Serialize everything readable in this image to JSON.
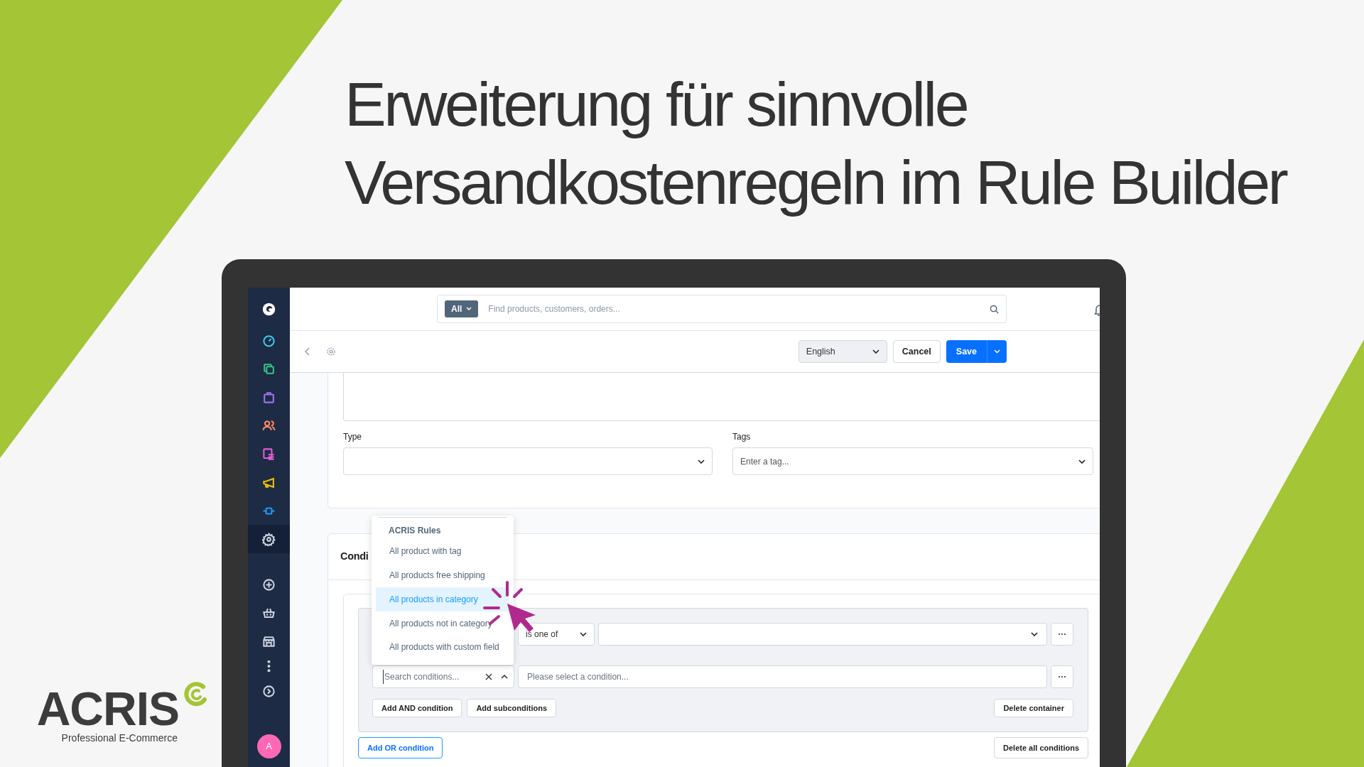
{
  "headline": {
    "lines": [
      "Erweiterung für sinnvolle",
      "Versandkostenregeln im Rule Builder"
    ]
  },
  "admin": {
    "sidebar": {
      "items": [
        {
          "color": "#45c8e8",
          "selected": false
        },
        {
          "color": "#37c47f",
          "selected": false
        },
        {
          "color": "#9b73f0",
          "selected": false
        },
        {
          "color": "#ff8a65",
          "selected": false
        },
        {
          "color": "#e35bd6",
          "selected": false
        },
        {
          "color": "#f2c200",
          "selected": false
        },
        {
          "color": "#189eff",
          "selected": false
        },
        {
          "color": "#c9d1dc",
          "selected": true
        },
        {
          "color": "#c9d1dc",
          "selected": false
        },
        {
          "color": "#c9d1dc",
          "selected": false
        },
        {
          "color": "#c9d1dc",
          "selected": false
        },
        {
          "color": "#c9d1dc",
          "selected": false
        },
        {
          "color": "#c9d1dc",
          "selected": false
        }
      ],
      "avatar": "A"
    },
    "search": {
      "scope": "All",
      "placeholder": "Find products, customers, orders..."
    },
    "toolbar": {
      "language": "English",
      "cancel": "Cancel",
      "save": "Save"
    },
    "form": {
      "type_label": "Type",
      "tags_label": "Tags",
      "tags_placeholder": "Enter a tag..."
    },
    "conditions": {
      "title": "Condi",
      "operator": "is one of",
      "search_placeholder": "Search conditions...",
      "condition_placeholder": "Please select a condition...",
      "add_and": "Add AND condition",
      "add_sub": "Add subconditions",
      "delete_container": "Delete container",
      "add_or": "Add OR condition",
      "delete_all": "Delete all conditions"
    },
    "dropdown": {
      "group": "ACRIS Rules",
      "items": [
        {
          "label": "All product with tag",
          "selected": false
        },
        {
          "label": "All products free shipping",
          "selected": false
        },
        {
          "label": "All products in category",
          "selected": true
        },
        {
          "label": "All products not in category",
          "selected": false
        },
        {
          "label": "All products with custom field",
          "selected": false
        }
      ]
    }
  },
  "logo": {
    "name": "ACRIS",
    "tagline": "Professional E-Commerce"
  }
}
